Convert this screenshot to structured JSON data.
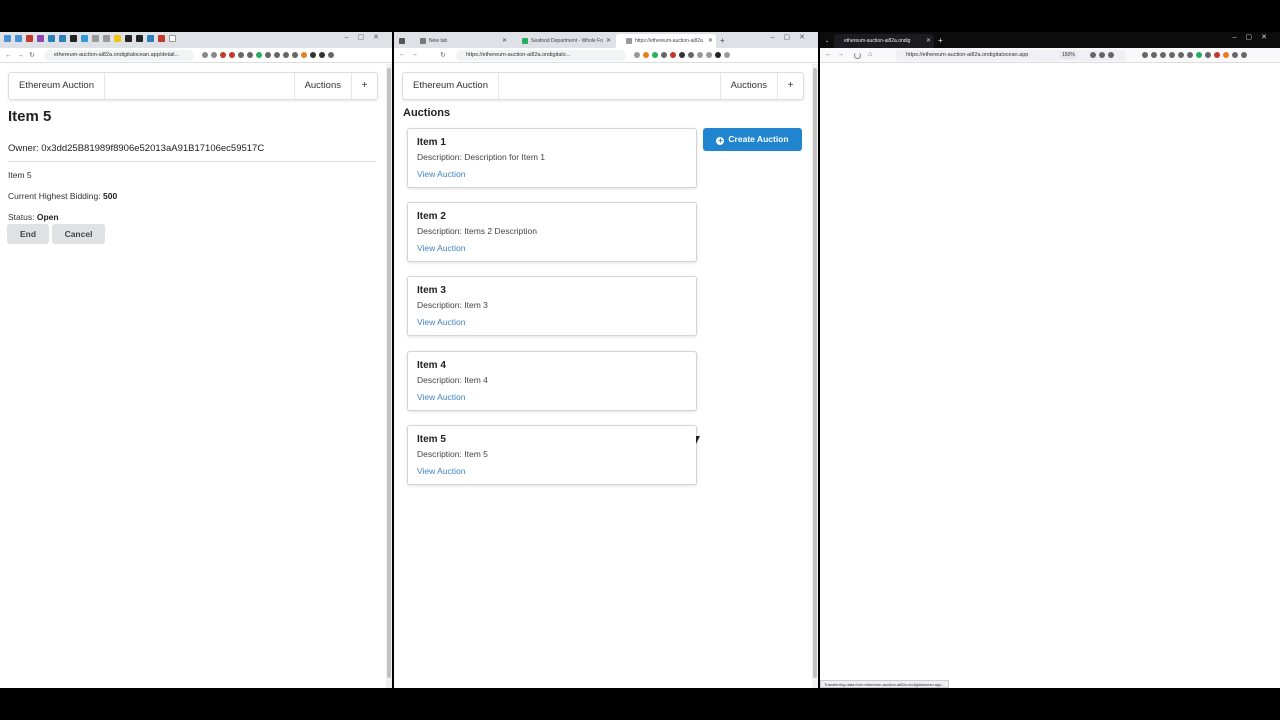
{
  "window1": {
    "url": "ethereum-auction-ai82a.ondigitalocean.app/detail...",
    "app": {
      "brand": "Ethereum Auction",
      "nav_auctions": "Auctions",
      "nav_plus": "+"
    },
    "detail": {
      "title": "Item 5",
      "owner_label": "Owner:",
      "owner_address": "0x3dd25B81989f8906e52013aA91B17106ec59517C",
      "item_name": "Item 5",
      "bid_label": "Current Highest Bidding:",
      "bid_value": "500",
      "status_label": "Status:",
      "status_value": "Open",
      "end_label": "End",
      "cancel_label": "Cancel"
    }
  },
  "window2": {
    "tabs": [
      {
        "label": "New tab"
      },
      {
        "label": "Seafood Department - Whole Fo"
      },
      {
        "label": "https://ethereum-auction-ai82a"
      }
    ],
    "new_tab": "+",
    "url": "https://ethereum-auction-ai82a.ondigitalo...",
    "app": {
      "brand": "Ethereum Auction",
      "nav_auctions": "Auctions",
      "nav_plus": "+"
    },
    "page_title": "Auctions",
    "create_label": "Create Auction",
    "auctions": [
      {
        "title": "Item 1",
        "description": "Description: Description for Item 1",
        "link": "View Auction"
      },
      {
        "title": "Item 2",
        "description": "Description: Items 2 Description",
        "link": "View Auction"
      },
      {
        "title": "Item 3",
        "description": "Description: Item 3",
        "link": "View Auction"
      },
      {
        "title": "Item 4",
        "description": "Description: Item 4",
        "link": "View Auction"
      },
      {
        "title": "Item 5",
        "description": "Description: Item 5",
        "link": "View Auction"
      }
    ]
  },
  "window3": {
    "tab_label": "ethereum-auction-ai82a.ondig",
    "new_tab": "+",
    "url": "https://ethereum-auction-ai82a.ondigitalocean.app",
    "zoom": "150%",
    "status_text": "Transferring data from ethereum-auction-ai82a.ondigitalocean.app..."
  },
  "colors": {
    "primary": "#2185d0",
    "link": "#4183c4",
    "secondary_button": "#e0e1e2"
  }
}
